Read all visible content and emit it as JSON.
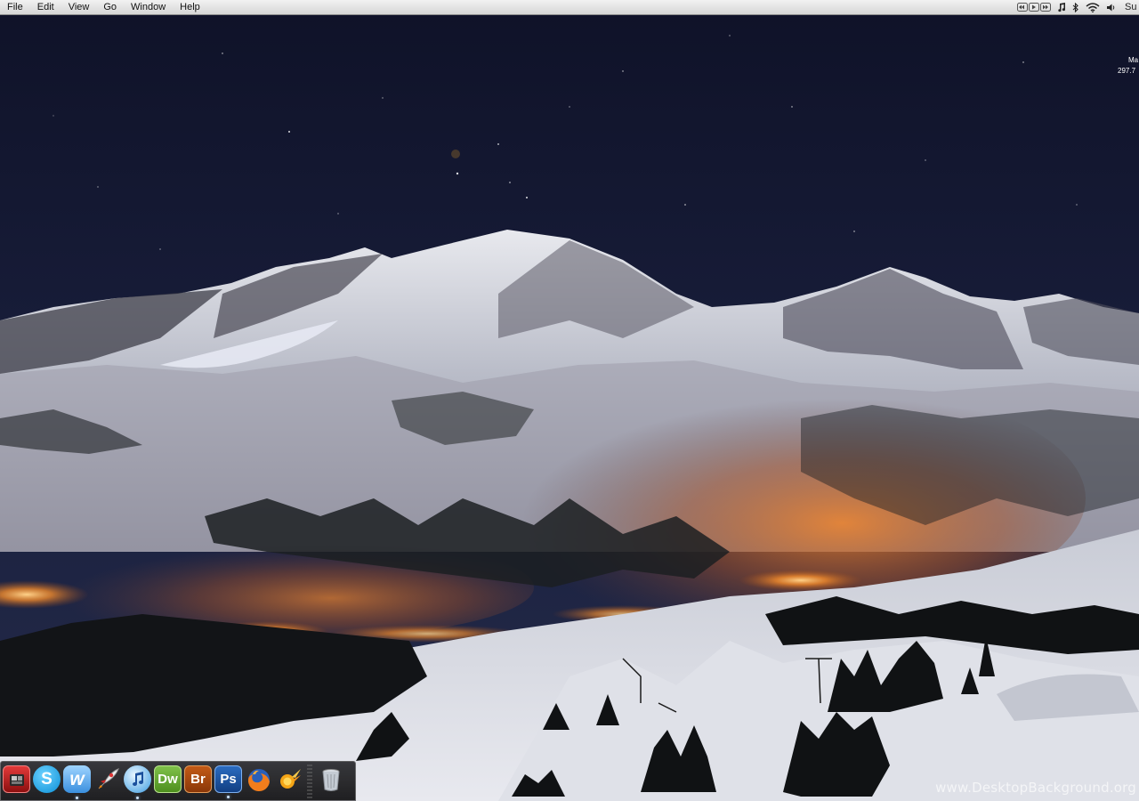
{
  "menubar": {
    "items": [
      "File",
      "Edit",
      "View",
      "Go",
      "Window",
      "Help"
    ],
    "extras": {
      "media_controls": "media-controls-icon",
      "music": "music-note-icon",
      "bluetooth": "bluetooth-icon",
      "wifi": "wifi-icon",
      "volume": "volume-icon",
      "clock_text": "Su"
    }
  },
  "widget": {
    "line1": "Ma",
    "line2": "297.7"
  },
  "dock": {
    "icons": [
      {
        "name": "photo-booth-icon",
        "label": ""
      },
      {
        "name": "skype-icon",
        "label": "S"
      },
      {
        "name": "iweb-icon",
        "label": "w"
      },
      {
        "name": "rocket-icon",
        "label": ""
      },
      {
        "name": "itunes-icon",
        "label": ""
      },
      {
        "name": "dreamweaver-icon",
        "label": "Dw"
      },
      {
        "name": "bridge-icon",
        "label": "Br"
      },
      {
        "name": "photoshop-icon",
        "label": "Ps"
      },
      {
        "name": "firefox-icon",
        "label": ""
      },
      {
        "name": "comet-icon",
        "label": ""
      },
      {
        "name": "trash-icon",
        "label": ""
      }
    ]
  },
  "watermark": "www.DesktopBackground.org",
  "colors": {
    "sky": "#141831",
    "snow": "#d9dbe2",
    "glow": "#f39a3a",
    "menubar": "#e8e8e8"
  }
}
